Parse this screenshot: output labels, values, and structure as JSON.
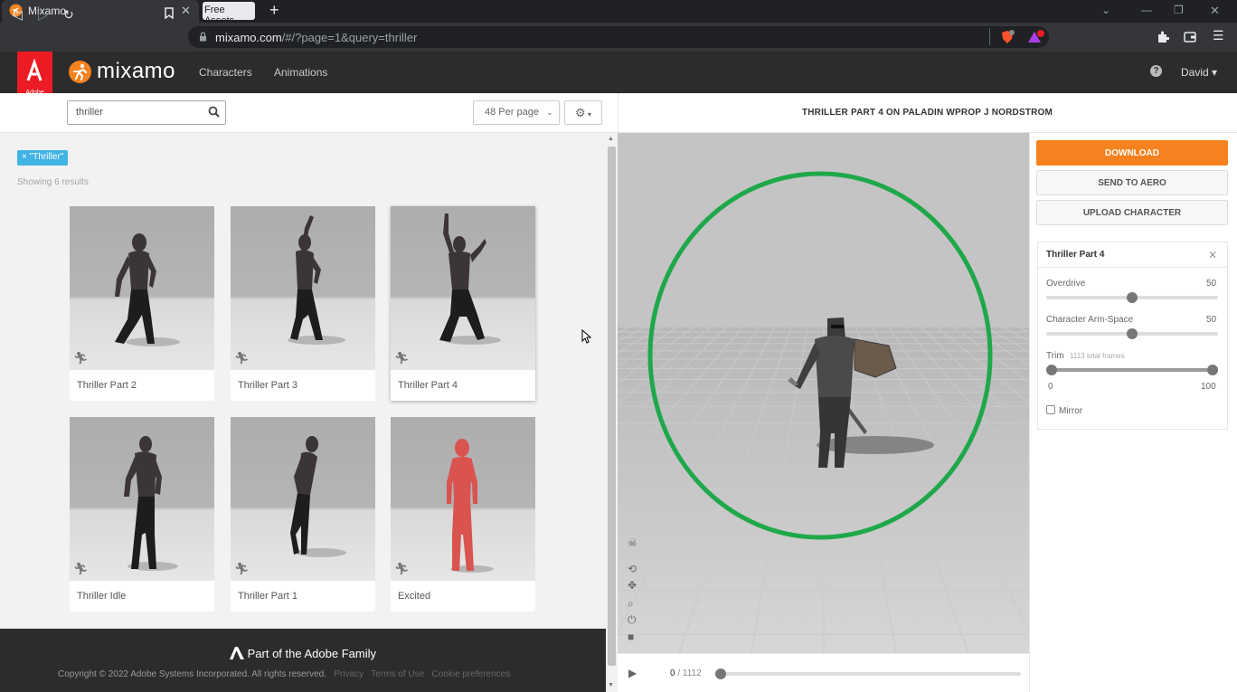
{
  "browser": {
    "tab_title": "Mixamo",
    "tab2_title": "Free Assets",
    "url_host": "mixamo.com",
    "url_path": "/#/?page=1&query=thriller"
  },
  "header": {
    "adobe_label": "Adobe",
    "app_name": "mixamo",
    "nav": [
      "Characters",
      "Animations"
    ],
    "user": "David"
  },
  "toolbar": {
    "search_value": "thriller",
    "per_page": "48 Per page"
  },
  "results": {
    "filter_tag": "× \"Thriller\"",
    "count_text": "Showing 6 results",
    "cards": [
      {
        "label": "Thriller Part 2",
        "type": "zombie"
      },
      {
        "label": "Thriller Part 3",
        "type": "zombie"
      },
      {
        "label": "Thriller Part 4",
        "type": "zombie"
      },
      {
        "label": "Thriller Idle",
        "type": "zombie"
      },
      {
        "label": "Thriller Part 1",
        "type": "zombie"
      },
      {
        "label": "Excited",
        "type": "mannequin"
      }
    ]
  },
  "footer": {
    "family": "Part of the Adobe Family",
    "copyright": "Copyright © 2022 Adobe Systems Incorporated. All rights reserved.",
    "links": [
      "Privacy",
      "Terms of Use",
      "Cookie preferences"
    ]
  },
  "viewer": {
    "title": "THRILLER PART 4 ON PALADIN WPROP J NORDSTROM",
    "frame_current": "0",
    "frame_total": "/ 1112",
    "progress": 0,
    "annotation_color": "#1fa84a"
  },
  "actions": {
    "download": "DOWNLOAD",
    "send": "SEND TO AERO",
    "upload": "UPLOAD CHARACTER"
  },
  "settings": {
    "title": "Thriller Part 4",
    "overdrive_label": "Overdrive",
    "overdrive_value": "50",
    "armspace_label": "Character Arm-Space",
    "armspace_value": "50",
    "trim_label": "Trim",
    "trim_frames": "1113 total frames",
    "trim_min": "0",
    "trim_max": "100",
    "mirror_label": "Mirror",
    "mirror_checked": false
  },
  "colors": {
    "accent": "#f5821f",
    "tag": "#40b4e5",
    "adobe_red": "#ed1c24"
  }
}
